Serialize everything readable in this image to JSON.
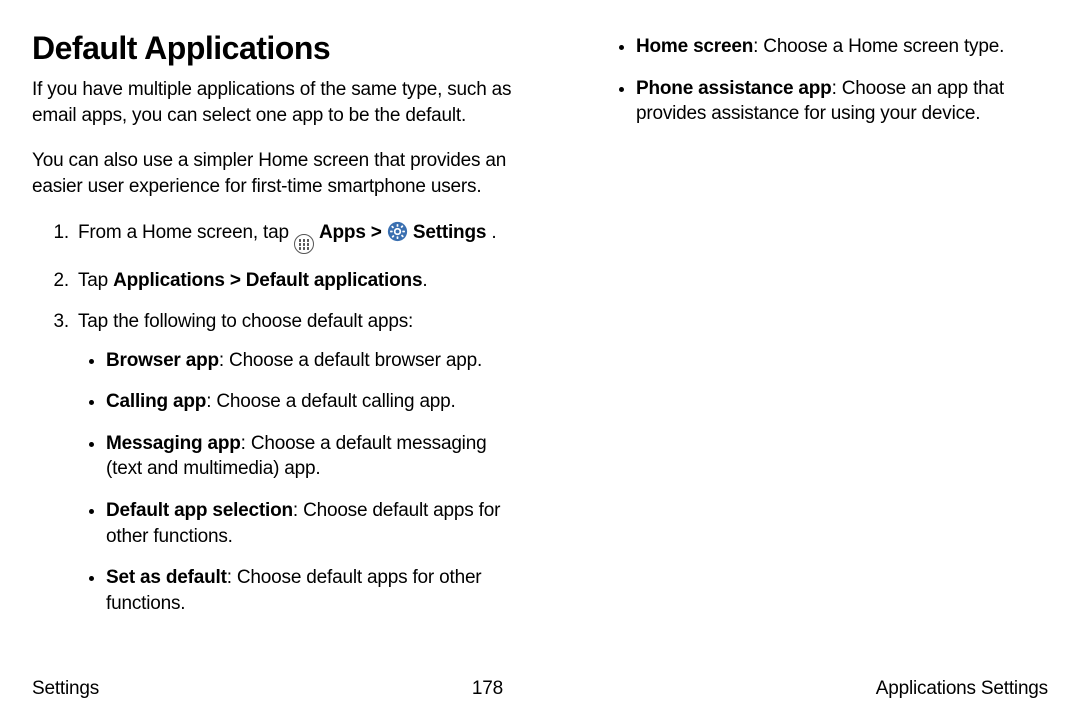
{
  "title": "Default Applications",
  "intro1": "If you have multiple applications of the same type, such as email apps, you can select one app to be the default.",
  "intro2": "You can also use a simpler Home screen that provides an easier user experience for first-time smartphone users.",
  "step1": {
    "pre": "From a Home screen, tap ",
    "apps": " Apps",
    "sep": " > ",
    "settings": " Settings",
    "end": "."
  },
  "step2": {
    "pre": "Tap ",
    "bold": "Applications > Default applications",
    "end": "."
  },
  "step3": "Tap the following to choose default apps:",
  "bullets_left": [
    {
      "term": "Browser app",
      "desc": ": Choose a default browser app."
    },
    {
      "term": "Calling app",
      "desc": ": Choose a default calling app."
    },
    {
      "term": "Messaging app",
      "desc": ": Choose a default messaging (text and multimedia) app."
    },
    {
      "term": "Default app selection",
      "desc": ": Choose default apps for other functions."
    },
    {
      "term": "Set as default",
      "desc": ": Choose default apps for other functions."
    }
  ],
  "bullets_right": [
    {
      "term": "Home screen",
      "desc": ": Choose a Home screen type."
    },
    {
      "term": "Phone assistance app",
      "desc": ": Choose an app that provides assistance for using your device."
    }
  ],
  "footer": {
    "left": "Settings",
    "center": "178",
    "right": "Applications Settings"
  }
}
